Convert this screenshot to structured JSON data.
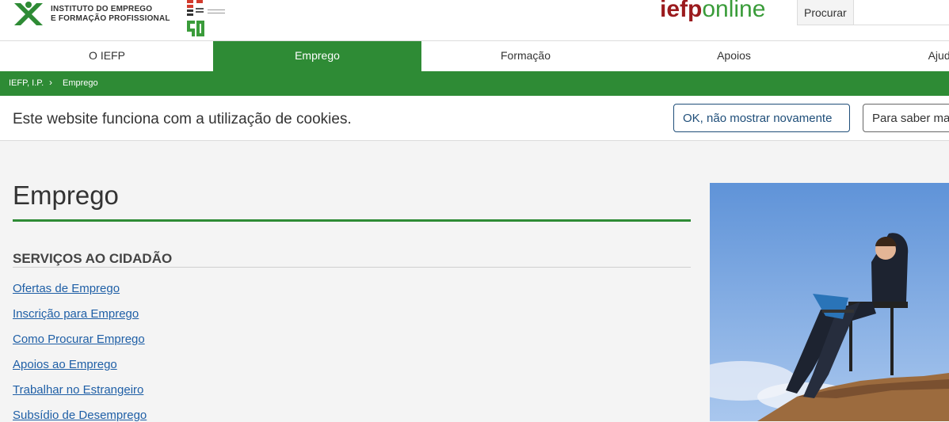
{
  "header": {
    "org_line1": "INSTITUTO DO EMPREGO",
    "org_line2": "E FORMAÇÃO PROFISSIONAL",
    "brand_part1": "iefp",
    "brand_part2": "online",
    "search_label": "Procurar",
    "search_value": ""
  },
  "nav": {
    "items": [
      "O IEFP",
      "Emprego",
      "Formação",
      "Apoios",
      "Ajuda"
    ],
    "active_index": 1
  },
  "breadcrumb": [
    "IEFP, I.P.",
    "Emprego"
  ],
  "cookie_banner": {
    "text": "Este website funciona com a utilização de cookies.",
    "ok_button": "OK, não mostrar novamente",
    "more_button": "Para saber mais"
  },
  "main": {
    "title": "Emprego",
    "section_title": "SERVIÇOS AO CIDADÃO",
    "links": [
      "Ofertas de Emprego",
      "Inscrição para Emprego",
      "Como Procurar Emprego",
      "Apoios ao Emprego",
      "Trabalhar no Estrangeiro",
      "Subsídio de Desemprego"
    ]
  },
  "colors": {
    "accent_green": "#2e8b35",
    "brand_red": "#9b1b1e",
    "link_blue": "#1f5fa6"
  }
}
